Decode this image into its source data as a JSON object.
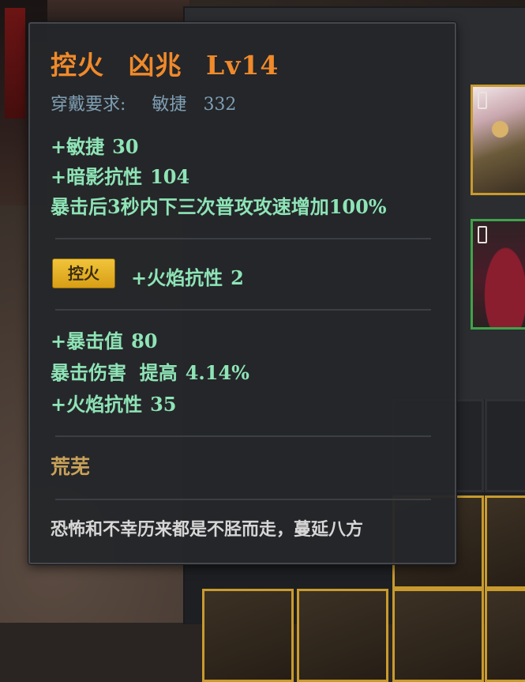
{
  "tooltip": {
    "title": {
      "prefix": "控火",
      "name": "凶兆",
      "level": "Lv14"
    },
    "requirement": {
      "label": "穿戴要求:",
      "stat": "敏捷",
      "value": "332"
    },
    "base_stats": [
      {
        "name": "+敏捷",
        "value": "30"
      },
      {
        "name": "+暗影抗性",
        "value": "104"
      }
    ],
    "special_effect": "暴击后3秒内下三次普攻攻速增加100%",
    "gem": {
      "tag": "控火",
      "stat": "+火焰抗性",
      "value": "2"
    },
    "extra_stats": [
      {
        "name": "+暴击值",
        "value": "80"
      },
      {
        "name": "暴击伤害  提高",
        "value": "4.14%"
      },
      {
        "name": "+火焰抗性",
        "value": "35"
      }
    ],
    "set_name": "荒芜",
    "flavor_text": "恐怖和不幸历来都是不胫而走，蔓延八方"
  },
  "colors": {
    "title": "#f08a2a",
    "requirement": "#7f9fb4",
    "stat": "#8ee4b6",
    "gem_tag": "#e8b42a",
    "set_name": "#c9a25a",
    "flavor": "#d6d6d6",
    "slot_gold": "#c99b2e",
    "slot_green": "#3fa34a"
  },
  "icons": {
    "helmet_slot": "helmet-icon",
    "boots_slot": "boots-icon",
    "lock": "lock-icon"
  }
}
